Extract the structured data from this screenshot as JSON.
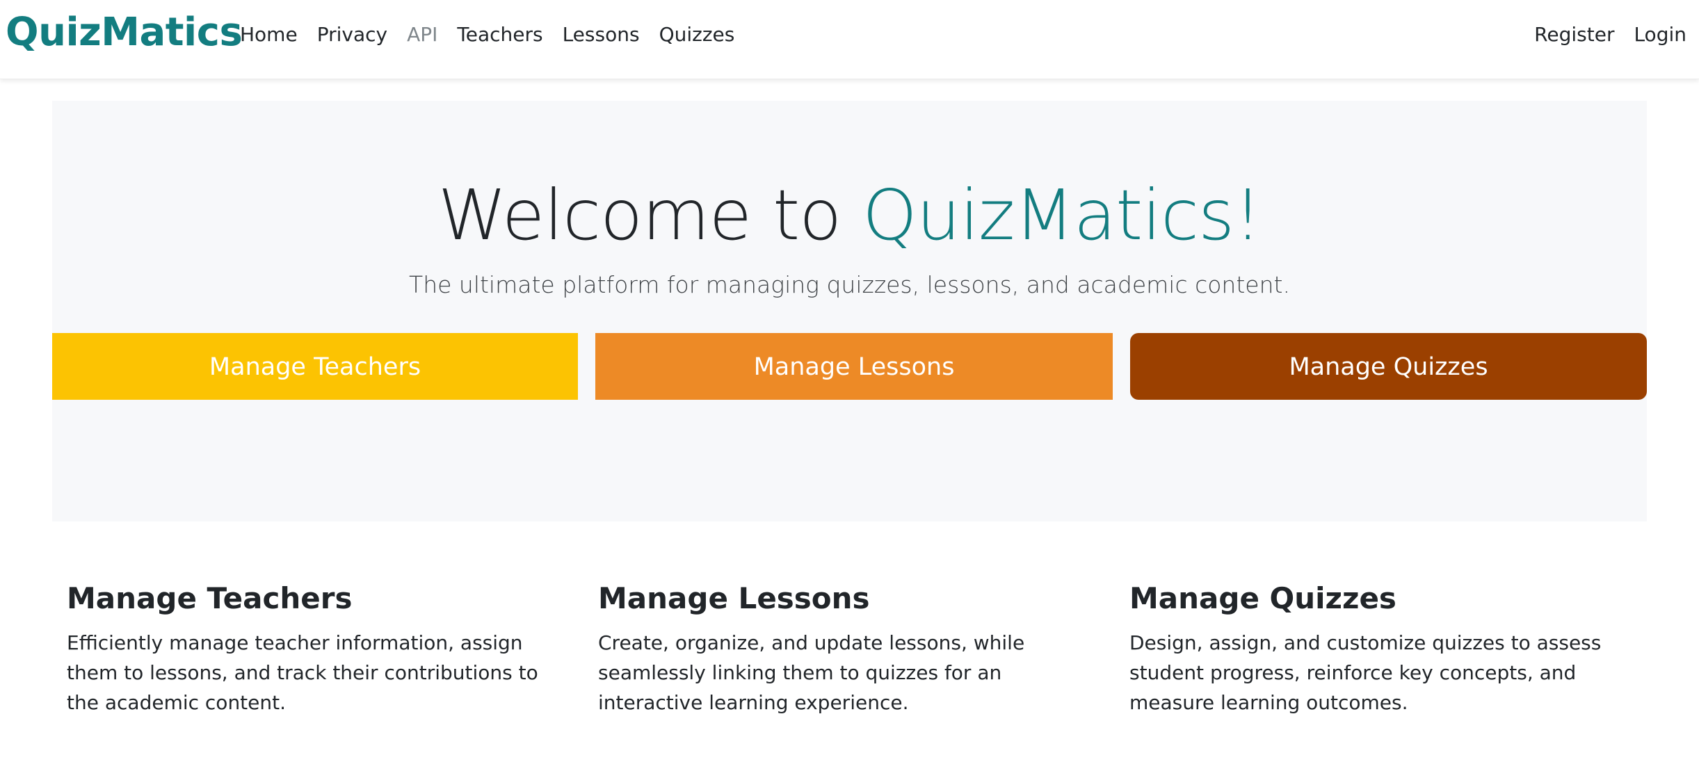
{
  "nav": {
    "brand": "QuizMatics",
    "links": [
      "Home",
      "Privacy",
      "API",
      "Teachers",
      "Lessons",
      "Quizzes"
    ],
    "right_links": [
      "Register",
      "Login"
    ]
  },
  "hero": {
    "title_prefix": "Welcome to ",
    "title_accent": "QuizMatics!",
    "subtitle": "The ultimate platform for managing quizzes, lessons, and academic content.",
    "buttons": [
      "Manage Teachers",
      "Manage Lessons",
      "Manage Quizzes"
    ]
  },
  "features": [
    {
      "title": "Manage Teachers",
      "text": "Efficiently manage teacher information, assign them to lessons, and track their contributions to the academic content."
    },
    {
      "title": "Manage Lessons",
      "text": "Create, organize, and update lessons, while seamlessly linking them to quizzes for an interactive learning experience."
    },
    {
      "title": "Manage Quizzes",
      "text": "Design, assign, and customize quizzes to assess student progress, reinforce key concepts, and measure learning outcomes."
    }
  ],
  "colors": {
    "brand": "#137d80",
    "teachers_button": "#fcc302",
    "lessons_button": "#ed8a26",
    "quizzes_button": "#9b4000",
    "hero_background": "#f7f8fa"
  }
}
